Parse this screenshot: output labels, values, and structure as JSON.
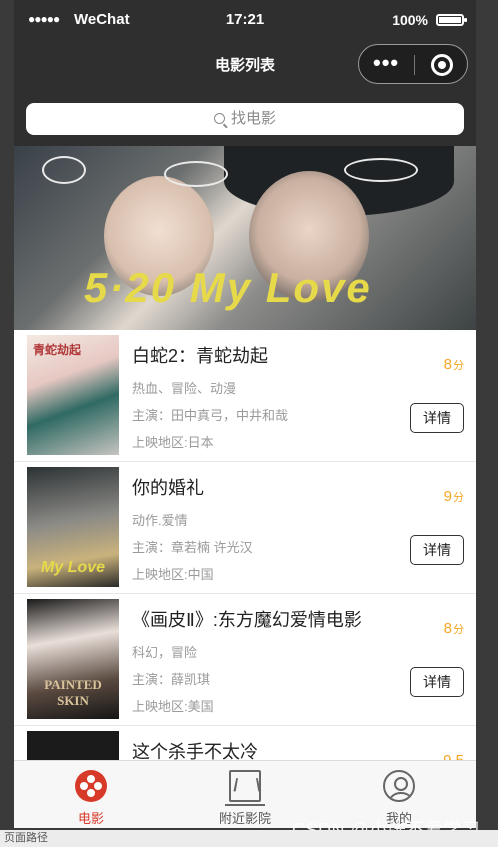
{
  "statusbar": {
    "signal": "●●●●●",
    "carrier": "WeChat",
    "time": "17:21",
    "battery": "100%"
  },
  "navbar": {
    "title": "电影列表",
    "menu_icon": "more-dots-icon",
    "close_icon": "mini-program-close-icon"
  },
  "search": {
    "placeholder": "找电影"
  },
  "banner": {
    "logo_text": "5·20 My Love"
  },
  "movies": [
    {
      "title": "白蛇2：青蛇劫起",
      "genre": "热血、冒险、动漫",
      "cast": "主演：田中真弓，中井和哉",
      "region": "上映地区:日本",
      "score": "8",
      "score_unit": "分",
      "button": "详情",
      "poster_mark": "青蛇劫起"
    },
    {
      "title": "你的婚礼",
      "genre": "动作.爱情",
      "cast": "主演：章若楠 许光汉",
      "region": "上映地区:中国",
      "score": "9",
      "score_unit": "分",
      "button": "详情",
      "poster_mark": "My Love"
    },
    {
      "title": "《画皮Ⅱ》:东方魔幻爱情电影",
      "genre": "科幻，冒险",
      "cast": "主演：薛凯琪",
      "region": "上映地区:美国",
      "score": "8",
      "score_unit": "分",
      "button": "详情",
      "poster_mark": "PAINTED SKIN"
    },
    {
      "title": "这个杀手不太冷",
      "genre": "",
      "cast": "",
      "region": "",
      "score": "9.5",
      "score_unit": "",
      "button": "",
      "poster_mark": ""
    }
  ],
  "tabbar": {
    "tabs": [
      {
        "label": "电影",
        "icon": "film-reel-icon",
        "active": true
      },
      {
        "label": "附近影院",
        "icon": "cinema-screen-icon",
        "active": false
      },
      {
        "label": "我的",
        "icon": "user-profile-icon",
        "active": false
      }
    ]
  },
  "watermark": "CSDN @小张不爱学习",
  "bottom_strip": "页面路径",
  "colors": {
    "accent": "#d83a2a",
    "score": "#f5a623",
    "background": "#2f2f2f"
  }
}
